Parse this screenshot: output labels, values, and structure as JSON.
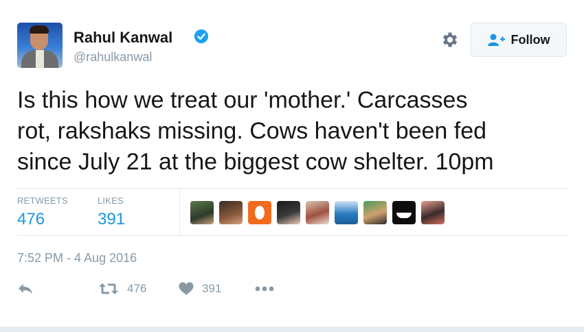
{
  "author": {
    "name": "Rahul Kanwal",
    "handle": "@rahulkanwal",
    "verified": true
  },
  "header": {
    "follow_label": "Follow"
  },
  "tweet": {
    "text_lines": [
      "Is this how we treat our 'mother.' Carcasses",
      "rot, rakshaks missing. Cows haven't been fed",
      "since July 21 at the biggest cow shelter. 10pm"
    ],
    "timestamp": "7:52 PM - 4 Aug 2016"
  },
  "stats": {
    "retweets_label": "RETWEETS",
    "retweets_value": "476",
    "likes_label": "LIKES",
    "likes_value": "391"
  },
  "actions": {
    "retweet_count": "476",
    "like_count": "391"
  },
  "likers_count_shown": 9,
  "colors": {
    "accent": "#1b95e0",
    "muted": "#8899a6",
    "verified": "#1da1f2",
    "text": "#14171a",
    "border": "#e1e8ed"
  },
  "icons": [
    "verified-badge-icon",
    "gear-icon",
    "follow-person-icon",
    "reply-icon",
    "retweet-icon",
    "heart-icon",
    "more-icon"
  ]
}
